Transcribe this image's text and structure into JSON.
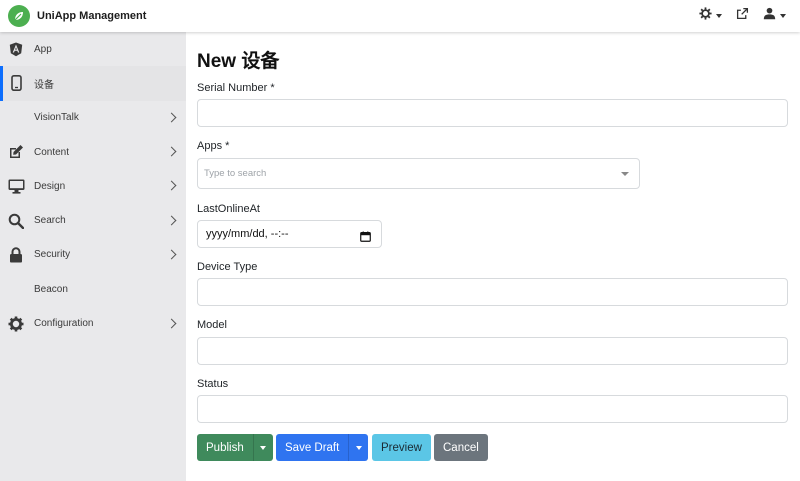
{
  "app": {
    "title": "UniApp Management"
  },
  "topbar": {
    "icons": [
      "gear-icon",
      "external-link-icon",
      "user-icon"
    ]
  },
  "sidebar": {
    "items": [
      {
        "label": "App",
        "icon": "angular-icon",
        "has_children": false,
        "active": false
      },
      {
        "label": "设备",
        "icon": "mobile-icon",
        "has_children": false,
        "active": true
      },
      {
        "label": "VisionTalk",
        "icon": "",
        "has_children": true,
        "active": false
      },
      {
        "label": "Content",
        "icon": "edit-icon",
        "has_children": true,
        "active": false
      },
      {
        "label": "Design",
        "icon": "desktop-icon",
        "has_children": true,
        "active": false
      },
      {
        "label": "Search",
        "icon": "search-icon",
        "has_children": true,
        "active": false
      },
      {
        "label": "Security",
        "icon": "lock-icon",
        "has_children": true,
        "active": false
      },
      {
        "label": "Beacon",
        "icon": "",
        "has_children": false,
        "active": false
      },
      {
        "label": "Configuration",
        "icon": "gear-icon",
        "has_children": true,
        "active": false
      }
    ]
  },
  "form": {
    "title": "New 设备",
    "serial_number": {
      "label": "Serial Number *",
      "value": ""
    },
    "apps": {
      "label": "Apps *",
      "placeholder": "Type to search"
    },
    "last_online_at": {
      "label": "LastOnlineAt",
      "value": "yyyy/mm/dd, --:--"
    },
    "device_type": {
      "label": "Device Type",
      "value": ""
    },
    "model": {
      "label": "Model",
      "value": ""
    },
    "status": {
      "label": "Status",
      "value": ""
    }
  },
  "actions": {
    "publish": "Publish",
    "save_draft": "Save Draft",
    "preview": "Preview",
    "cancel": "Cancel"
  },
  "colors": {
    "accent": "#0d6efd",
    "publish": "#3f8a5c",
    "save_draft": "#2f74f0",
    "preview": "#5bc6e6",
    "cancel": "#6c757d",
    "sidebar_bg": "#e9e9eb"
  }
}
